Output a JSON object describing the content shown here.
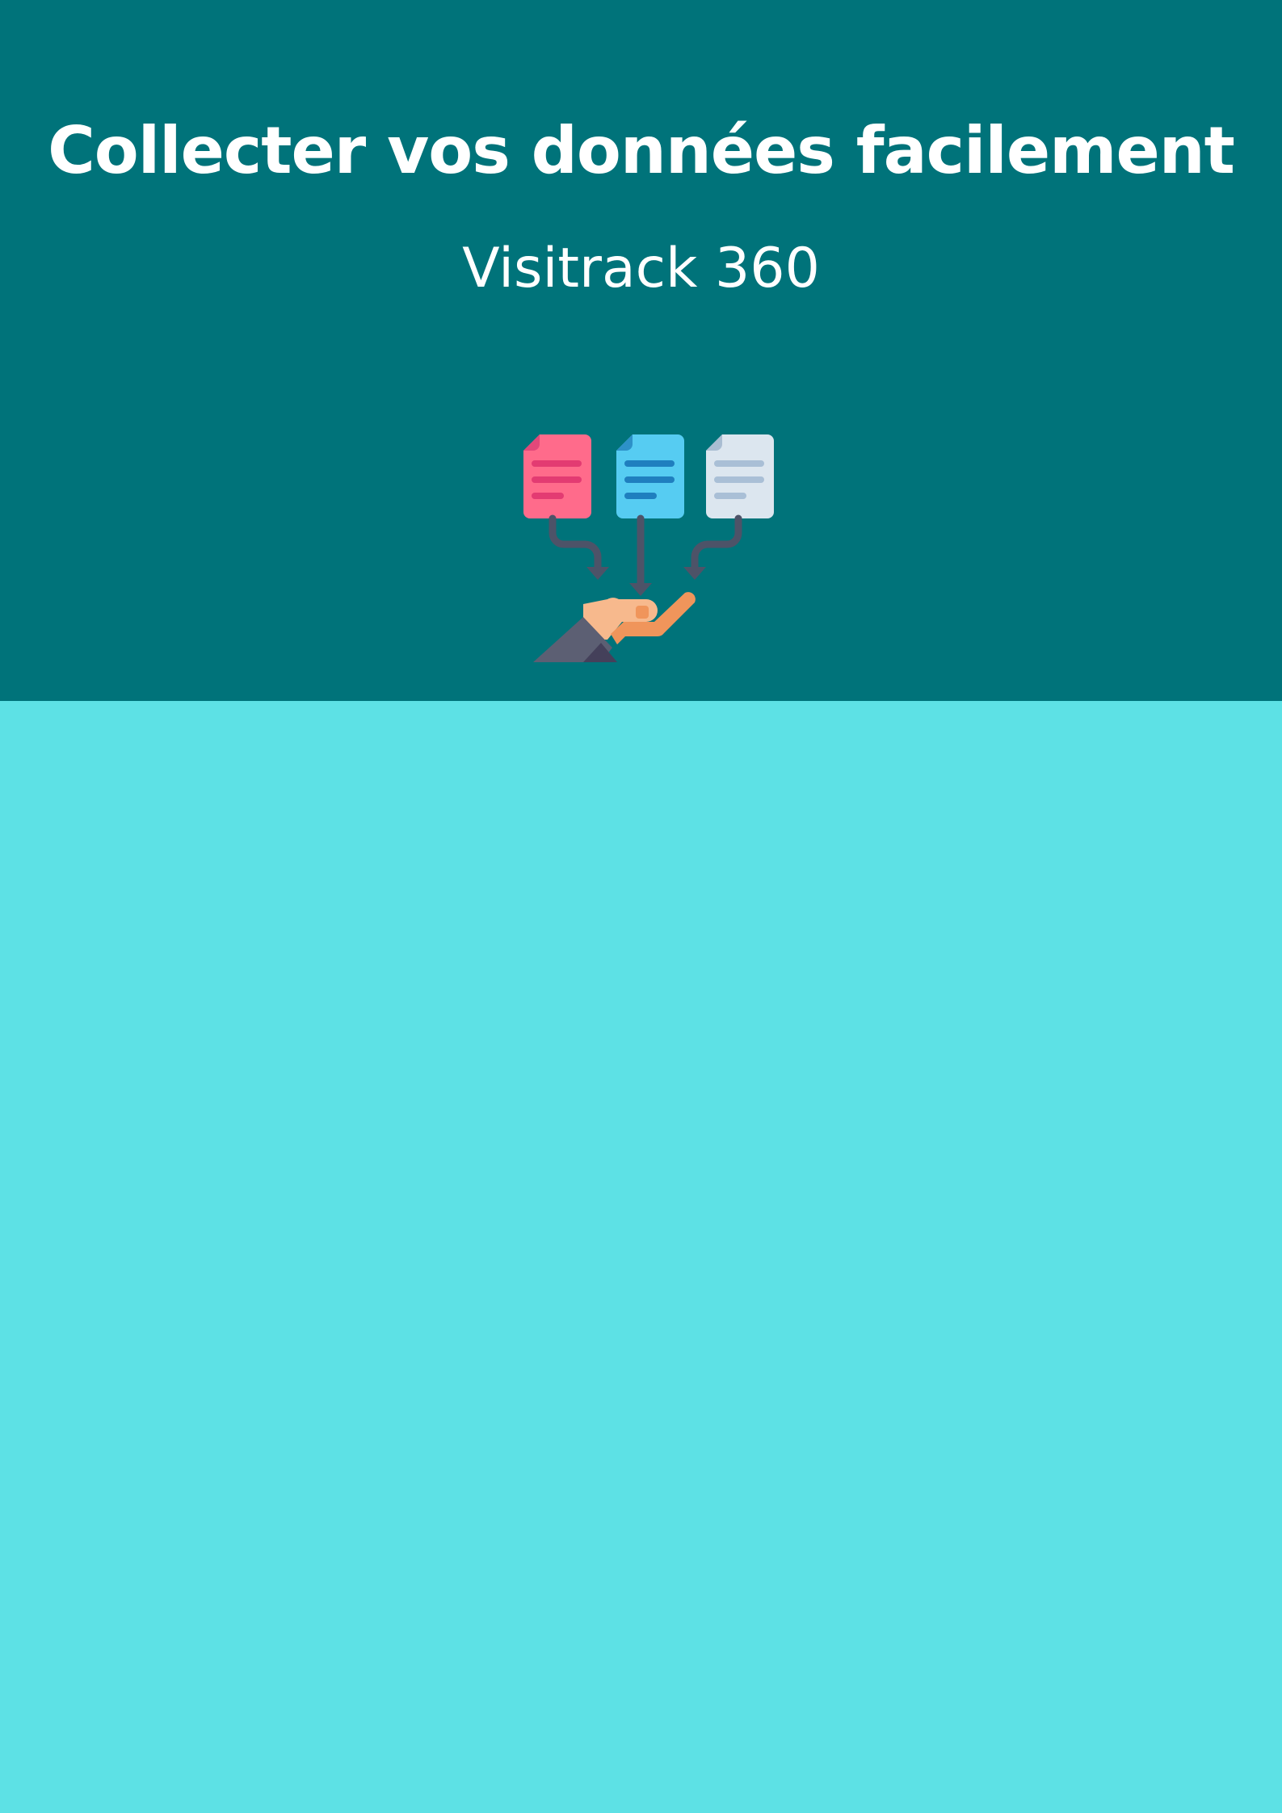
{
  "document": {
    "title": "Collecter vos données facilement",
    "subtitle": "Visitrack 360"
  },
  "colors": {
    "header_background": "#00737a",
    "page_background": "#5de1e5",
    "text": "#ffffff",
    "doc_pink": "#ff6b8b",
    "doc_blue": "#56ccf2",
    "doc_gray": "#dce6ef",
    "arrow": "#4d5368",
    "hand_skin": "#f7b98d",
    "hand_orange": "#f0955b",
    "sleeve": "#5c5f73"
  },
  "illustration": {
    "icon": "data-collection-icon"
  }
}
